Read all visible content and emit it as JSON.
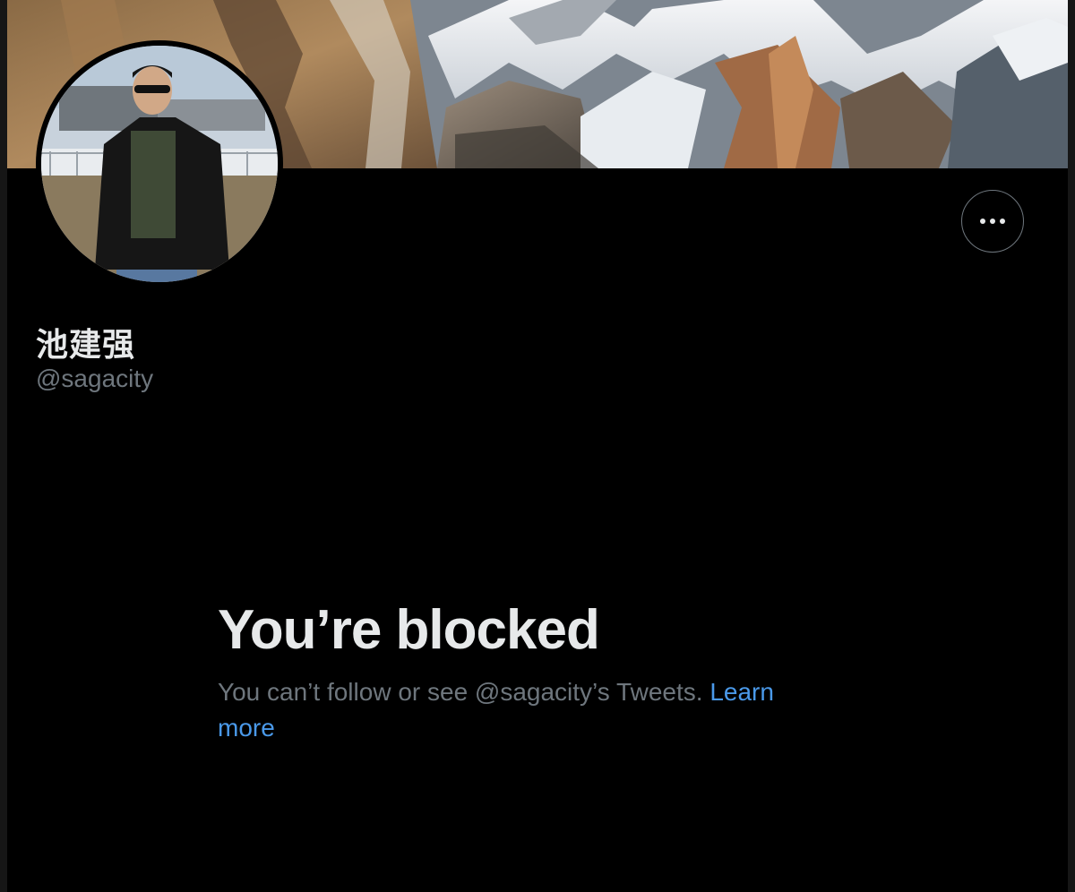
{
  "profile": {
    "display_name": "池建强",
    "handle": "@sagacity"
  },
  "blocked": {
    "title": "You’re blocked",
    "message": "You can’t follow or see @sagacity’s Tweets.",
    "link_label": "Learn more"
  },
  "icons": {
    "more": "more-horizontal-icon"
  },
  "colors": {
    "background": "#000000",
    "primary_text": "#e7e9ea",
    "secondary_text": "#6e767d",
    "link": "#4a99e9"
  }
}
